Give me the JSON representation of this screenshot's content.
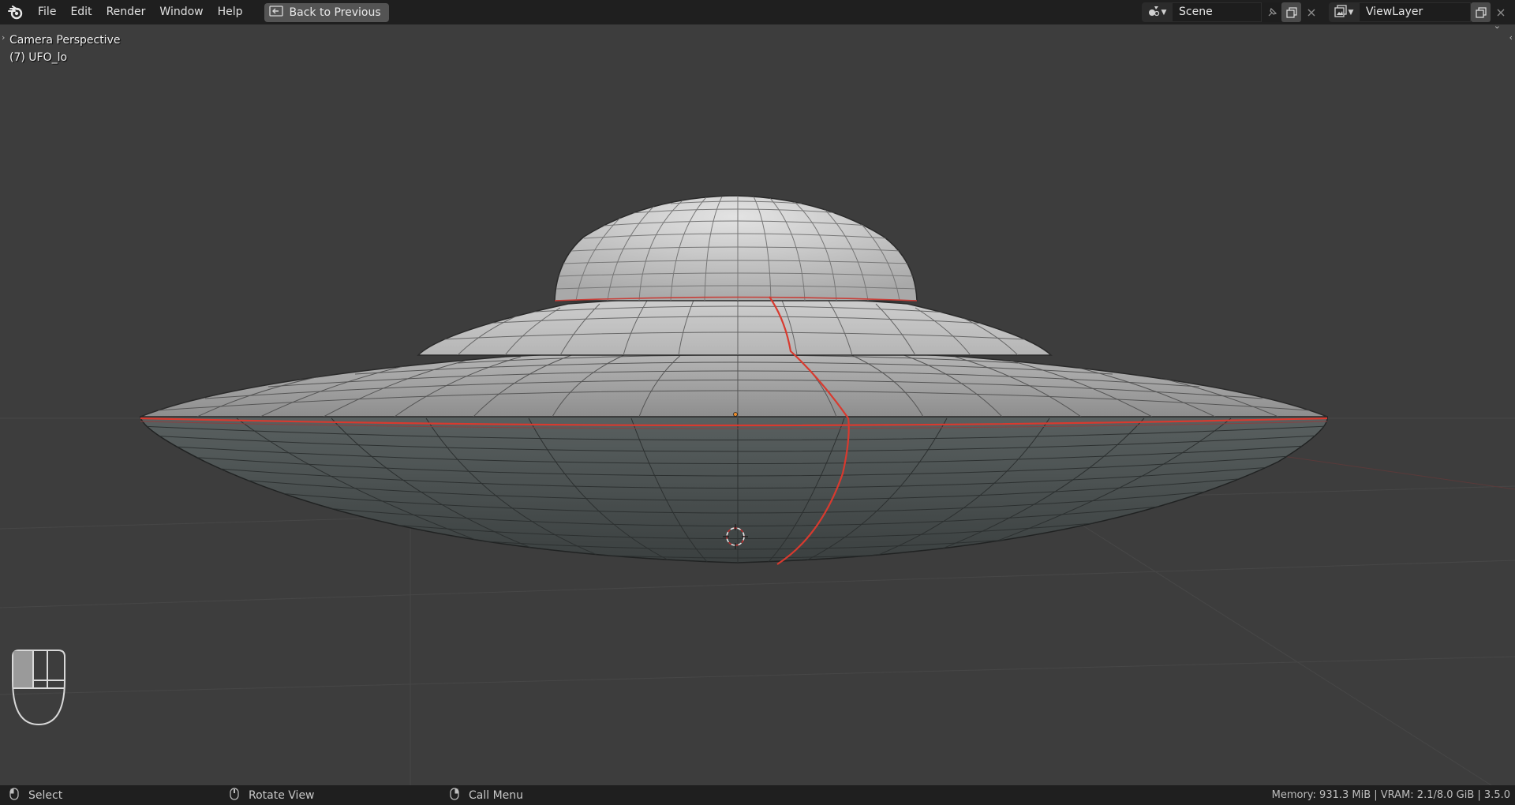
{
  "menu": {
    "items": [
      "File",
      "Edit",
      "Render",
      "Window",
      "Help"
    ],
    "back_button": "Back to Previous"
  },
  "header": {
    "scene_name": "Scene",
    "view_layer_name": "ViewLayer"
  },
  "viewport": {
    "view_name": "Camera Perspective",
    "object_label": "(7) UFO_lo"
  },
  "status": {
    "select_label": "Select",
    "rotate_label": "Rotate View",
    "menu_label": "Call Menu",
    "info": "Memory: 931.3 MiB | VRAM: 2.1/8.0 GiB | 3.5.0"
  },
  "icons": [
    "blender-logo-icon",
    "back-icon",
    "scene-icon",
    "pin-icon",
    "copy-icon",
    "close-icon",
    "view-layer-icon",
    "mouse-icon",
    "cursor-3d-icon",
    "origin-dot-icon"
  ],
  "colors": {
    "seam": "#d83a2f",
    "background": "#3d3d3d",
    "header": "#1f1f1f"
  }
}
